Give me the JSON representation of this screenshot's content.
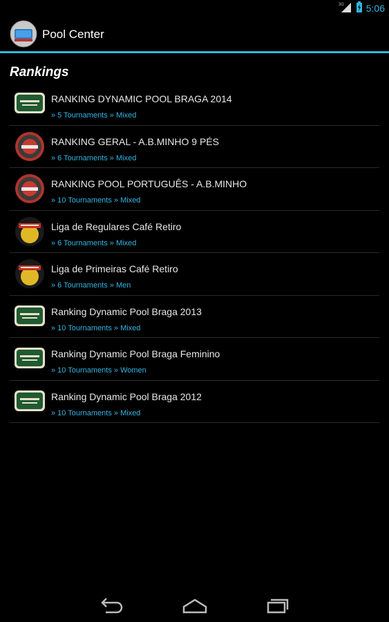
{
  "status_bar": {
    "time": "5:06",
    "network": "3G"
  },
  "app": {
    "title": "Pool Center",
    "icon": "pool-table-icon"
  },
  "section": {
    "title": "Rankings"
  },
  "accent_color": "#33b5e5",
  "rankings": [
    {
      "title": "RANKING DYNAMIC POOL BRAGA 2014",
      "subtitle": "» 5 Tournaments » Mixed",
      "icon": "dynamic-pool-logo-icon"
    },
    {
      "title": "RANKING GERAL - A.B.MINHO 9 PÉS",
      "subtitle": "» 6 Tournaments » Mixed",
      "icon": "ab-minho-logo-icon"
    },
    {
      "title": "RANKING POOL PORTUGUÊS - A.B.MINHO",
      "subtitle": "» 10 Tournaments » Mixed",
      "icon": "ab-minho-logo-icon"
    },
    {
      "title": "Liga de Regulares Café Retiro",
      "subtitle": "» 6 Tournaments » Mixed",
      "icon": "cafe-retiro-logo-icon"
    },
    {
      "title": "Liga de Primeiras Café Retiro",
      "subtitle": "» 6 Tournaments » Men",
      "icon": "cafe-retiro-logo-icon"
    },
    {
      "title": "Ranking Dynamic Pool Braga 2013",
      "subtitle": "» 10 Tournaments » Mixed",
      "icon": "dynamic-pool-logo-icon"
    },
    {
      "title": "Ranking Dynamic Pool Braga Feminino",
      "subtitle": "» 10 Tournaments » Women",
      "icon": "dynamic-pool-logo-icon"
    },
    {
      "title": "Ranking Dynamic Pool Braga 2012",
      "subtitle": "» 10 Tournaments » Mixed",
      "icon": "dynamic-pool-logo-icon"
    }
  ],
  "nav": {
    "back": "back-icon",
    "home": "home-icon",
    "recents": "recent-apps-icon"
  }
}
